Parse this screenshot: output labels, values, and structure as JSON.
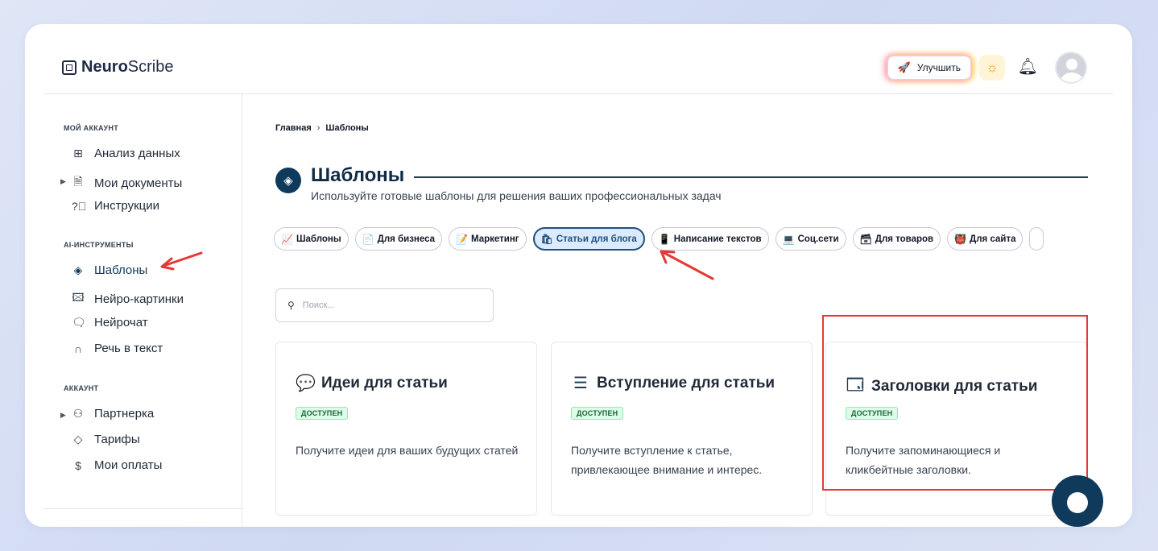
{
  "brand": {
    "bold": "Neuro",
    "light": "Scribe"
  },
  "header": {
    "upgrade_label": "Улучшить"
  },
  "sidebar": {
    "sections": [
      {
        "title": "МОЙ АККАУНТ"
      },
      {
        "title": "AI-ИНСТРУМЕНТЫ"
      },
      {
        "title": "АККАУНТ"
      }
    ],
    "items": [
      {
        "label": "Анализ данных",
        "icon": "grid-icon"
      },
      {
        "label": "Мои документы",
        "icon": "document-icon"
      },
      {
        "label": "Инструкции",
        "icon": "help-icon"
      },
      {
        "label": "Шаблоны",
        "icon": "layers-icon"
      },
      {
        "label": "Нейро-картинки",
        "icon": "image-icon"
      },
      {
        "label": "Нейрочат",
        "icon": "chat-icon"
      },
      {
        "label": "Речь в текст",
        "icon": "headphones-icon"
      },
      {
        "label": "Партнерка",
        "icon": "users-icon"
      },
      {
        "label": "Тарифы",
        "icon": "tag-icon"
      },
      {
        "label": "Мои оплаты",
        "icon": "dollar-icon"
      }
    ]
  },
  "breadcrumb": {
    "home": "Главная",
    "sep": "›",
    "current": "Шаблоны"
  },
  "page": {
    "title": "Шаблоны",
    "subtitle": "Используйте готовые шаблоны для решения ваших профессиональных задач"
  },
  "chips": [
    {
      "emoji": "📈",
      "label": "Шаблоны"
    },
    {
      "emoji": "📄",
      "label": "Для бизнеса"
    },
    {
      "emoji": "📝",
      "label": "Маркетинг"
    },
    {
      "emoji": "🛍",
      "label": "Статьи для блога"
    },
    {
      "emoji": "📱",
      "label": "Написание текстов"
    },
    {
      "emoji": "💻",
      "label": "Соц.сети"
    },
    {
      "emoji": "🗃",
      "label": "Для товаров"
    },
    {
      "emoji": "👹",
      "label": "Для сайта"
    }
  ],
  "search": {
    "placeholder": "Поиск..."
  },
  "cards": [
    {
      "emoji": "💬",
      "title": "Идеи для статьи",
      "badge": "ДОСТУПЕН",
      "desc": "Получите идеи для ваших будущих статей"
    },
    {
      "emoji": "☰",
      "title": "Вступление для статьи",
      "badge": "ДОСТУПЕН",
      "desc": "Получите вступление к статье, привлекающее внимание и интерес."
    },
    {
      "emoji": "🗔",
      "title": "Заголовки для статьи",
      "badge": "ДОСТУПЕН",
      "desc": "Получите запоминающиеся и кликбейтные заголовки."
    }
  ],
  "colors": {
    "primary": "#0f3a5c",
    "accent_highlight": "#e53935",
    "badge_bg": "#dcfce7"
  }
}
